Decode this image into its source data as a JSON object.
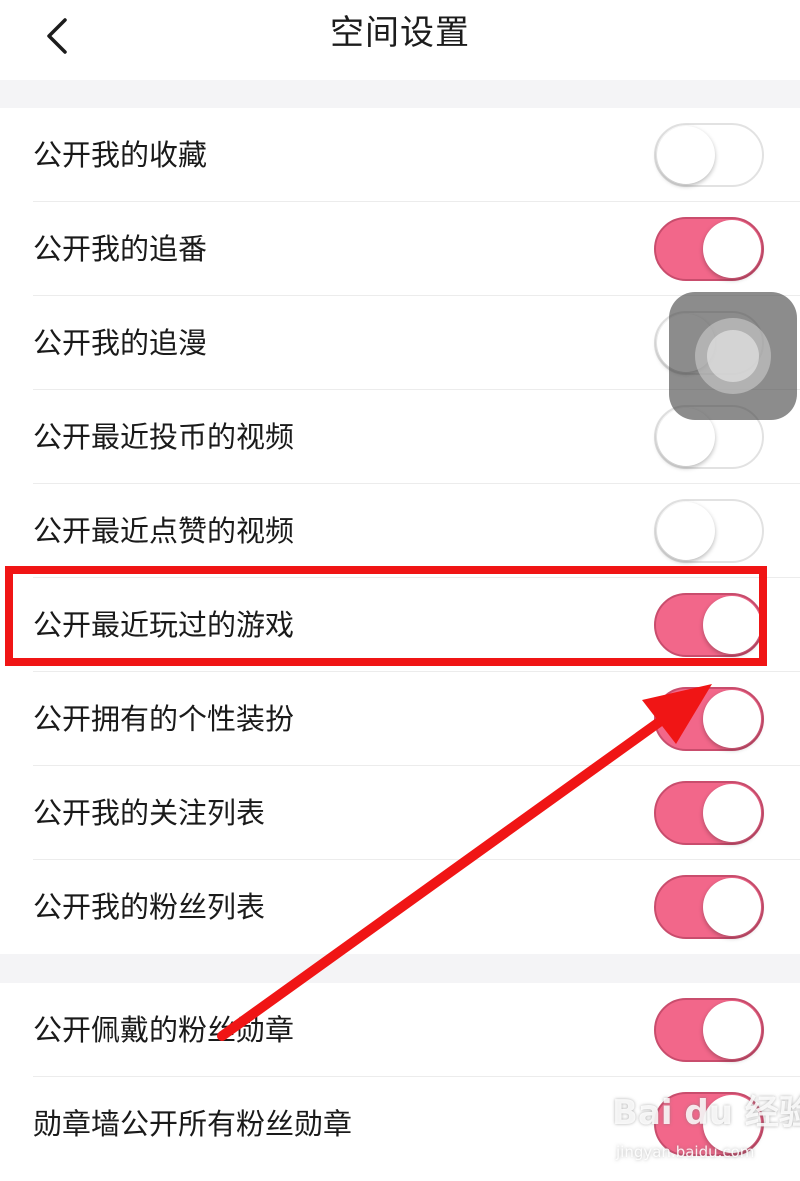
{
  "header": {
    "title": "空间设置"
  },
  "settings": {
    "group1": [
      {
        "label": "公开我的收藏",
        "on": false
      },
      {
        "label": "公开我的追番",
        "on": true
      },
      {
        "label": "公开我的追漫",
        "on": false
      },
      {
        "label": "公开最近投币的视频",
        "on": false
      },
      {
        "label": "公开最近点赞的视频",
        "on": false
      },
      {
        "label": "公开最近玩过的游戏",
        "on": true
      },
      {
        "label": "公开拥有的个性装扮",
        "on": true
      },
      {
        "label": "公开我的关注列表",
        "on": true
      },
      {
        "label": "公开我的粉丝列表",
        "on": true
      }
    ],
    "group2": [
      {
        "label": "公开佩戴的粉丝勋章",
        "on": true
      },
      {
        "label": "勋章墙公开所有粉丝勋章",
        "on": true
      }
    ]
  },
  "colors": {
    "accent": "#f2678a",
    "annotation": "#f01515"
  },
  "icons": {
    "back": "chevron-left-icon",
    "floating": "assistive-touch-icon"
  },
  "watermark": {
    "main": "Bai du 经验",
    "sub": "jingyan.baidu.com"
  }
}
